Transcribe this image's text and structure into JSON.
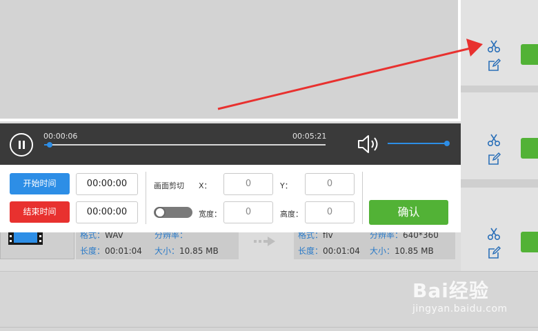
{
  "player": {
    "current_time": "00:00:06",
    "total_time": "00:05:21",
    "progress": 0.019,
    "volume": 1.0
  },
  "panel": {
    "start_button": "开始时间",
    "end_button": "结束时间",
    "start_value": "00:00:00",
    "end_value": "00:00:00",
    "crop_label": "画面剪切",
    "x_label": "X：",
    "y_label": "Y：",
    "width_label": "宽度：",
    "height_label": "高度：",
    "x_value": "0",
    "y_value": "0",
    "width_value": "0",
    "height_value": "0",
    "confirm_button": "确认"
  },
  "file_source": {
    "format_label": "格式：",
    "format_value": "WAV",
    "resolution_label": "分辨率：",
    "resolution_value": "",
    "length_label": "长度：",
    "length_value": "00:01:04",
    "size_label": "大小：",
    "size_value": "10.85 MB"
  },
  "file_target": {
    "format_label": "格式：",
    "format_value": "flv",
    "resolution_label": "分辨率：",
    "resolution_value": "640*360",
    "length_label": "长度：",
    "length_value": "00:01:04",
    "size_label": "大小：",
    "size_value": "10.85 MB"
  },
  "watermark": {
    "logo": "Bai经验",
    "url": "jingyan.baidu.com"
  },
  "colors": {
    "accent_blue": "#2d8ee6",
    "danger_red": "#e8312f",
    "confirm_green": "#52b236",
    "annotation_red": "#e8312f"
  },
  "icons": [
    "scissors-icon",
    "edit-icon",
    "pause-icon",
    "speaker-icon",
    "film-icon",
    "arrow-right-icon"
  ]
}
